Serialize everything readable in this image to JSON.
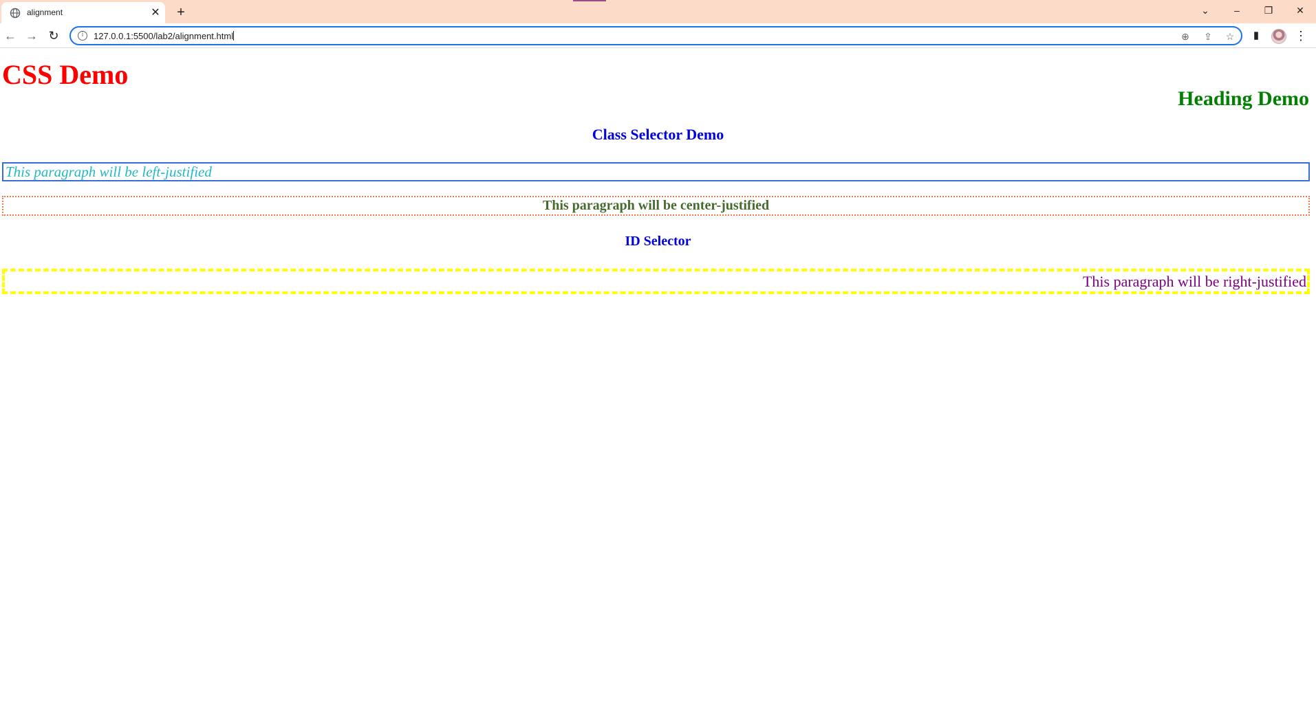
{
  "browser": {
    "tab": {
      "title": "alignment",
      "close_label": "✕",
      "icon": "globe-icon"
    },
    "new_tab_label": "+",
    "window_controls": {
      "tab_search": "⌄",
      "minimize": "–",
      "restore": "❐",
      "close": "✕"
    },
    "nav": {
      "back": "←",
      "forward": "→",
      "reload": "↻"
    },
    "address": {
      "url": "127.0.0.1:5500/lab2/alignment.html",
      "info_glyph": "i"
    },
    "omnibox_icons": [
      "zoom-icon",
      "share-icon",
      "bookmark-star-icon"
    ],
    "icons": {
      "zoom": "⊕",
      "share": "⇪",
      "star": "☆",
      "side_panel": "▮",
      "menu": "⋮"
    },
    "colors": {
      "titlebar": "#fcdcc8",
      "focus": "#1a73e8"
    }
  },
  "page": {
    "heading1": "CSS Demo",
    "heading2": "Heading Demo",
    "class_heading": "Class Selector Demo",
    "left_paragraph": "This paragraph will be left-justified",
    "center_paragraph": "This paragraph will be center-justified",
    "id_heading": "ID Selector",
    "right_paragraph": "This paragraph will be right-justified",
    "colors": {
      "heading1": "#ff0000",
      "heading2": "#008000",
      "headings3": "#0000e0",
      "left_text": "#20b8c8",
      "center_text": "#456b2f",
      "right_text": "#800080"
    }
  }
}
